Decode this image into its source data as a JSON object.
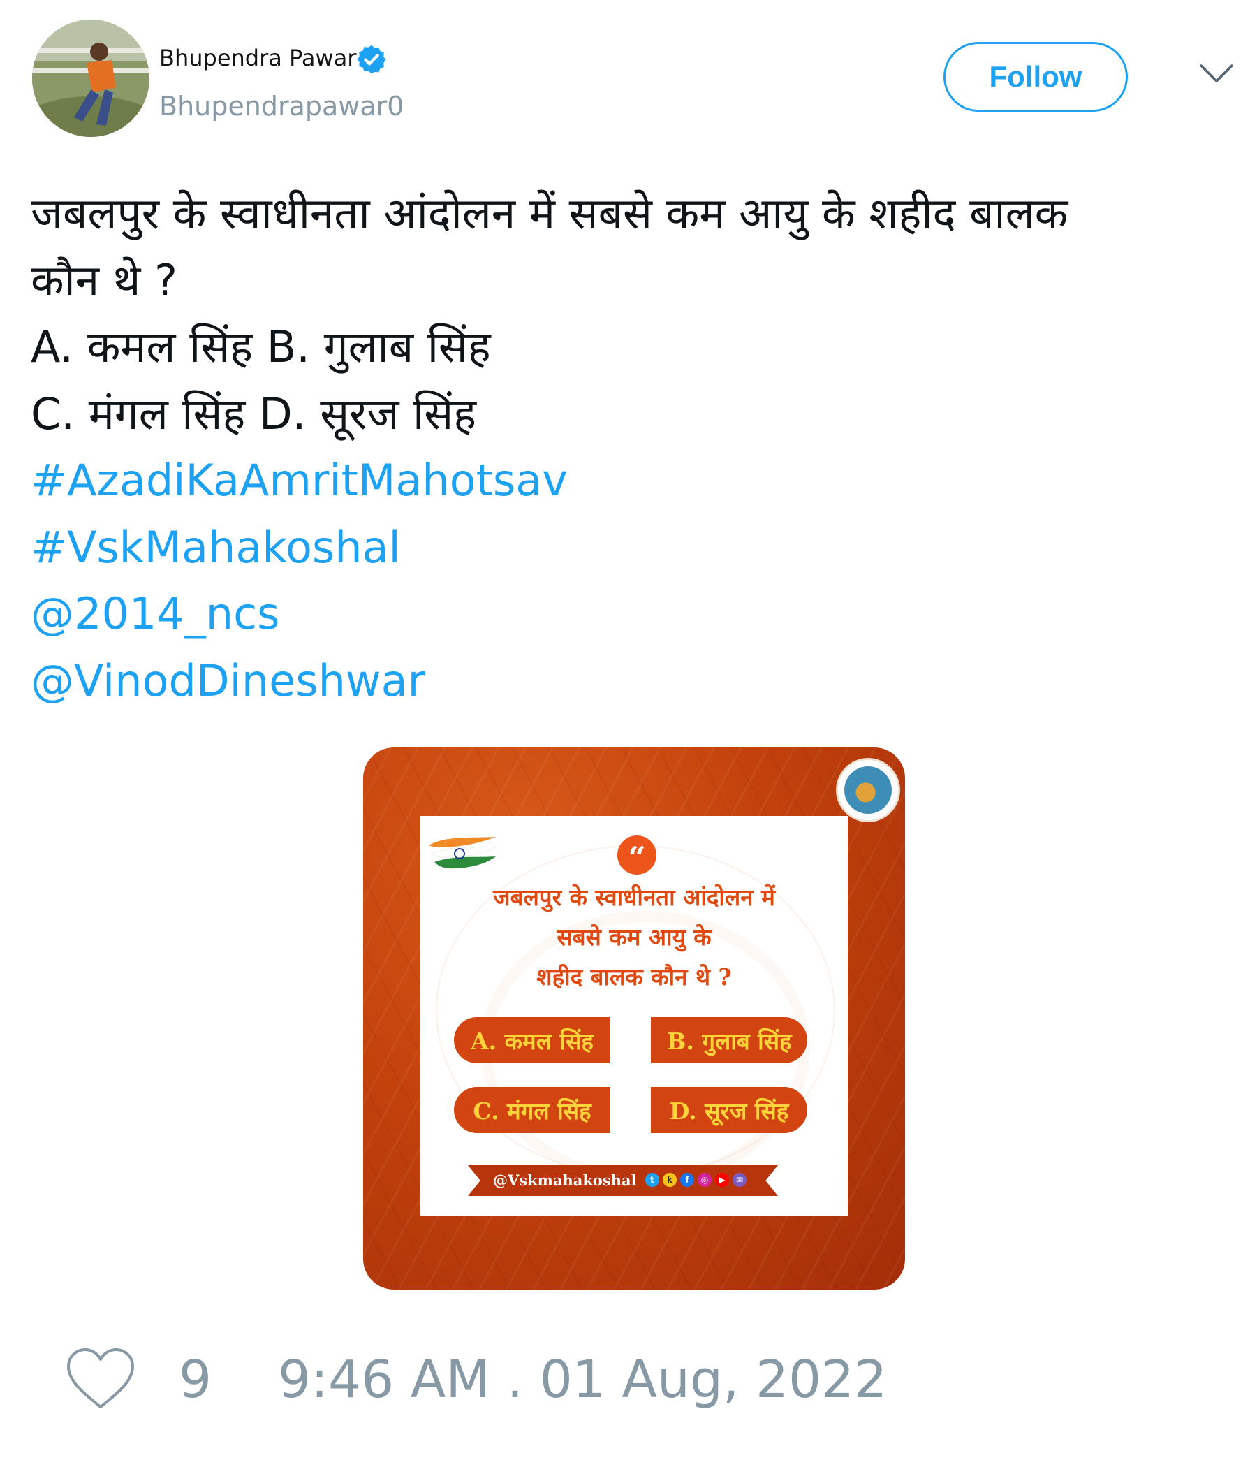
{
  "header": {
    "display_name": "Bhupendra Pawar",
    "handle": "Bhupendrapawar0",
    "follow_label": "Follow",
    "verified": true,
    "accent_color": "#1da1f2"
  },
  "tweet": {
    "lines": [
      "जबलपुर के स्वाधीनता आंदोलन में सबसे कम आयु के शहीद बालक",
      "कौन थे ?",
      "A. कमल सिंह B. गुलाब सिंह",
      "C. मंगल सिंह D. सूरज सिंह"
    ],
    "links": [
      "#AzadiKaAmritMahotsav",
      "#VskMahakoshal",
      "@2014_ncs",
      "@VinodDineshwar"
    ]
  },
  "media": {
    "question_lines": [
      "जबलपुर के स्वाधीनता आंदोलन में",
      "सबसे कम आयु के",
      "शहीद बालक कौन थे ?"
    ],
    "options": [
      "A. कमल सिंह",
      "B. गुलाब सिंह",
      "C. मंगल सिंह",
      "D. सूरज सिंह"
    ],
    "footer_handle": "@Vskmahakoshal",
    "social_icons": [
      "twitter-icon",
      "koo-icon",
      "facebook-icon",
      "instagram-icon",
      "youtube-icon",
      "mail-icon"
    ]
  },
  "footer": {
    "like_count": "9",
    "timestamp": "9:46 AM . 01 Aug, 2022"
  }
}
